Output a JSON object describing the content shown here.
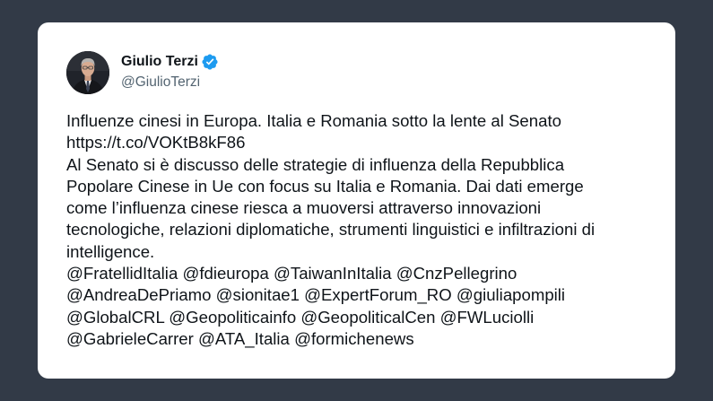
{
  "author": {
    "name": "Giulio Terzi",
    "handle": "@GiulioTerzi",
    "verified": true,
    "verified_icon": "verified-badge-icon",
    "verified_color": "#1d9bf0"
  },
  "tweet": {
    "lines": [
      "Influenze cinesi in Europa. Italia e Romania sotto la lente al Senato",
      "https://t.co/VOKtB8kF86",
      "Al Senato si è discusso delle strategie di influenza della Repubblica",
      "Popolare Cinese in Ue con focus su Italia e Romania. Dai dati emerge",
      "come l’influenza cinese riesca a muoversi attraverso innovazioni",
      "tecnologiche, relazioni diplomatiche, strumenti linguistici e infiltrazioni di",
      "intelligence.",
      "@FratellidItalia @fdieuropa @TaiwanInItalia @CnzPellegrino",
      "@AndreaDePriamo @sionitae1 @ExpertForum_RO @giuliapompili",
      "@GlobalCRL @Geopoliticainfo @GeopoliticalCen @FWLuciolli",
      "@GabrieleCarrer @ATA_Italia @formichenews"
    ]
  },
  "colors": {
    "background": "#323a47",
    "card": "#ffffff",
    "text": "#0f1419",
    "secondary_text": "#536471"
  }
}
